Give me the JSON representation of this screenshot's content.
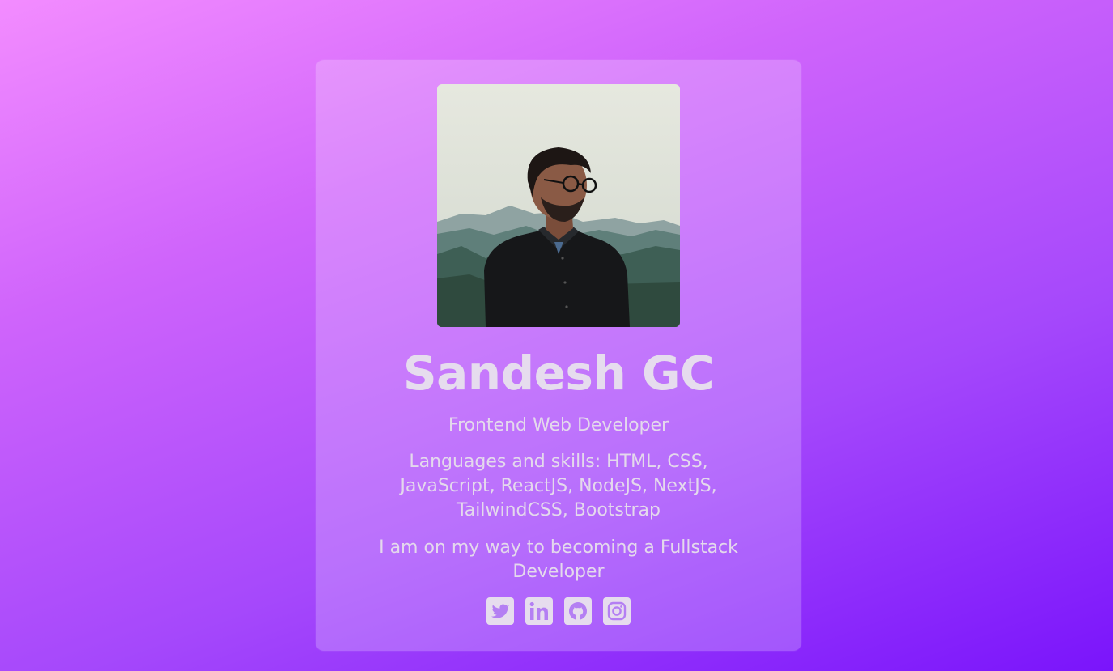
{
  "profile": {
    "photo_alt": "Sandesh GC",
    "name": "Sandesh GC",
    "role": "Frontend Web Developer",
    "skills": "Languages and skills: HTML, CSS, JavaScript, ReactJS, NodeJS, NextJS, TailwindCSS, Bootstrap",
    "goal": "I am on my way to becoming a Fullstack Developer"
  },
  "socials": [
    {
      "icon": "twitter-icon"
    },
    {
      "icon": "linkedin-icon"
    },
    {
      "icon": "github-icon"
    },
    {
      "icon": "instagram-icon"
    }
  ],
  "colors": {
    "background_start": "#f38cff",
    "background_end": "#7a14fb",
    "text": "#e4d9ec"
  }
}
